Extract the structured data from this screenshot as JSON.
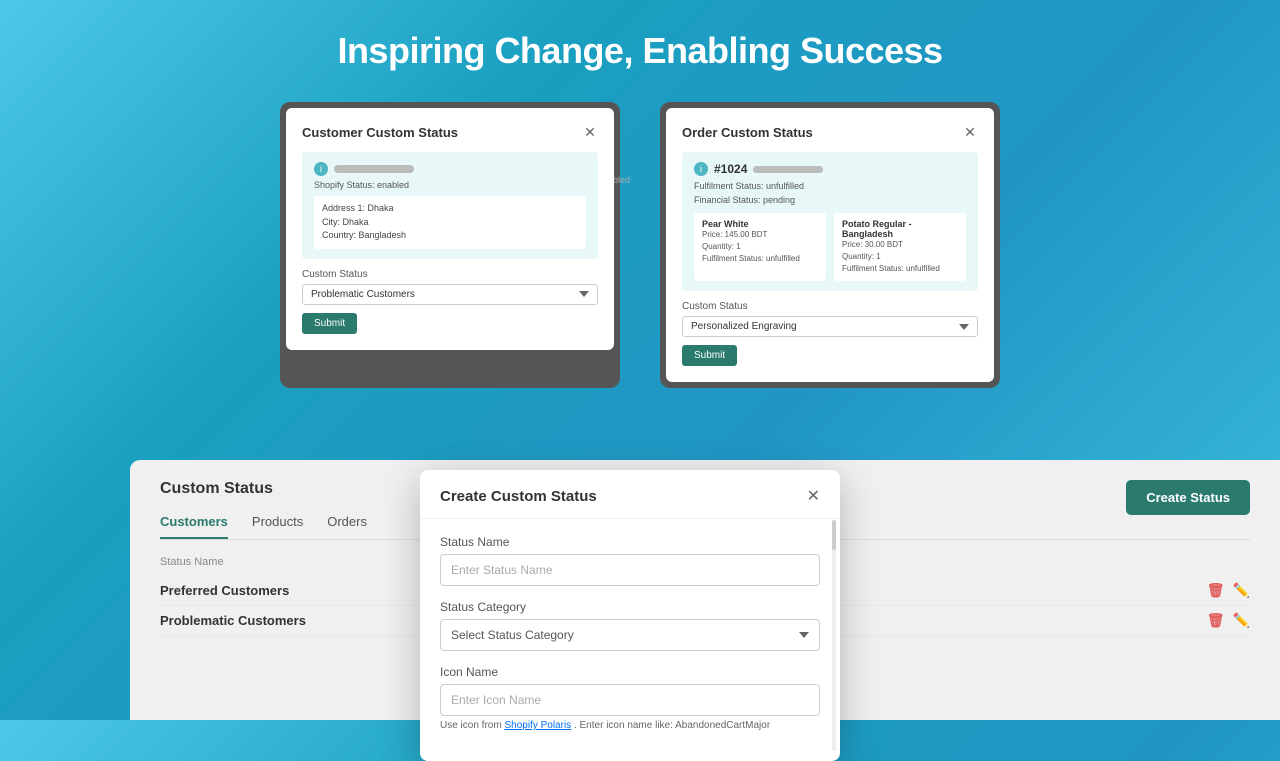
{
  "hero": {
    "title": "Inspiring Change, Enabling Success"
  },
  "customer_modal": {
    "title": "Customer Custom Status",
    "customer_name_blur": true,
    "shopify_status": "Shopify Status: enabled",
    "address_line1": "Address 1: Dhaka",
    "city": "City: Dhaka",
    "country": "Country: Bangladesh",
    "custom_status_label": "Custom Status",
    "dropdown_value": "Problematic Customers",
    "submit_label": "Submit"
  },
  "order_modal": {
    "title": "Order Custom Status",
    "order_id": "#1024",
    "fulfillment_status": "Fulfilment Status: unfulfilled",
    "financial_status": "Financial Status: pending",
    "product1": {
      "name": "Pear White",
      "price": "Price: 145.00 BDT",
      "quantity": "Quantity: 1",
      "fulfillment": "Fulfilment Status: unfulfilled"
    },
    "product2": {
      "name": "Potato Regular - Bangladesh",
      "price": "Price: 30.00 BDT",
      "quantity": "Quantity: 1",
      "fulfillment": "Fulfilment Status: unfulfilled"
    },
    "custom_status_label": "Custom Status",
    "dropdown_value": "Personalized Engraving",
    "submit_label": "Submit"
  },
  "bottom_panel": {
    "title": "Custom Status",
    "tabs": [
      "Customers",
      "Products",
      "Orders"
    ],
    "active_tab": "Customers",
    "table_header": "Status Name",
    "rows": [
      "Preferred Customers",
      "Problematic Customers"
    ],
    "create_btn": "Create Status"
  },
  "create_modal": {
    "title": "Create Custom Status",
    "status_name_label": "Status Name",
    "status_name_placeholder": "Enter Status Name",
    "status_category_label": "Status Category",
    "status_category_placeholder": "Select Status Category",
    "icon_name_label": "Icon Name",
    "icon_name_placeholder": "Enter Icon Name",
    "hint_text": "Use icon from",
    "hint_link": "Shopify Polaris",
    "hint_suffix": ". Enter icon name like: AbandonedCartMajor"
  },
  "bg_labels": {
    "disabled": "disabled",
    "unfulfilled": "unfulfilled"
  }
}
